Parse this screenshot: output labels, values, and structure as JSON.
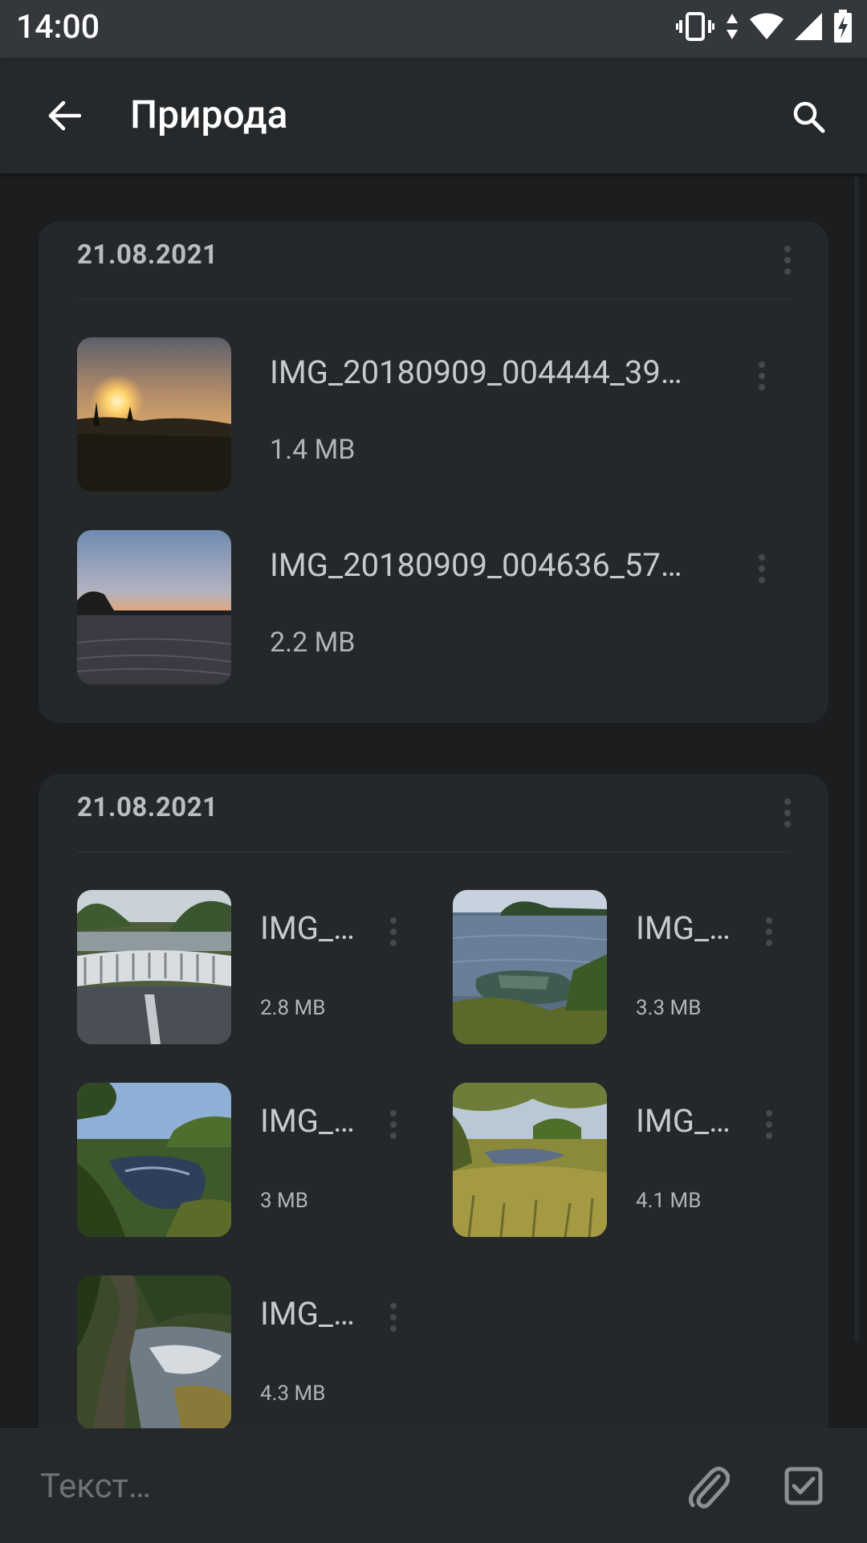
{
  "status_bar": {
    "time": "14:00"
  },
  "app_bar": {
    "title": "Природа"
  },
  "groups": [
    {
      "date": "21.08.2021",
      "files": [
        {
          "name": "IMG_20180909_004444_39…",
          "size": "1.4 MB"
        },
        {
          "name": "IMG_20180909_004636_57…",
          "size": "2.2 MB"
        }
      ]
    },
    {
      "date": "21.08.2021",
      "files": [
        {
          "name": "IMG_…",
          "size": "2.8 MB"
        },
        {
          "name": "IMG_…",
          "size": "3.3 MB"
        },
        {
          "name": "IMG_…",
          "size": "3 MB"
        },
        {
          "name": "IMG_…",
          "size": "4.1 MB"
        },
        {
          "name": "IMG_…",
          "size": "4.3 MB"
        }
      ]
    }
  ],
  "input": {
    "placeholder": "Текст…"
  },
  "icons": {
    "back": "arrow-back-icon",
    "search": "search-icon",
    "attach": "paperclip-icon",
    "select": "checkbox-icon",
    "menu": "more-vert-icon"
  }
}
